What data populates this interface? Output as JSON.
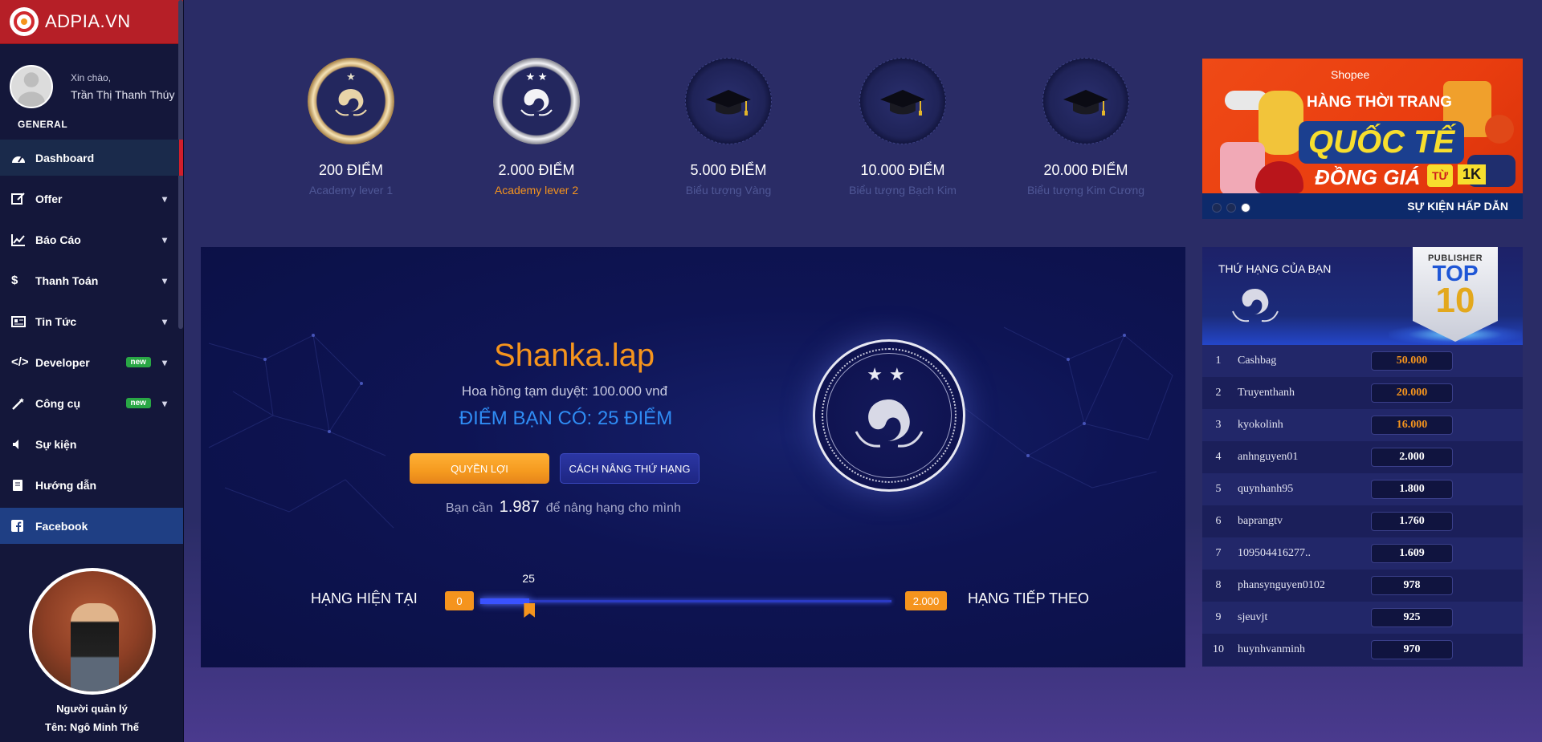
{
  "sidebar": {
    "brand": "ADPIA.VN",
    "greeting": "Xin chào,",
    "user_name": "Trần Thị Thanh Thúy",
    "section": "GENERAL",
    "items": [
      {
        "label": "Dashboard",
        "icon": "dashboard-icon"
      },
      {
        "label": "Offer",
        "icon": "edit-icon"
      },
      {
        "label": "Báo Cáo",
        "icon": "chart-icon"
      },
      {
        "label": "Thanh Toán",
        "icon": "dollar-icon"
      },
      {
        "label": "Tin Tức",
        "icon": "newspaper-icon"
      },
      {
        "label": "Developer",
        "icon": "code-icon",
        "badge": "new"
      },
      {
        "label": "Công cụ",
        "icon": "magic-wand-icon",
        "badge": "new"
      },
      {
        "label": "Sự kiện",
        "icon": "volume-icon"
      },
      {
        "label": "Hướng dẫn",
        "icon": "book-icon"
      },
      {
        "label": "Facebook",
        "icon": "facebook-icon"
      }
    ],
    "manager_role": "Người quản lý",
    "manager_name": "Tên: Ngô Minh Thế"
  },
  "levels": [
    {
      "points": "200 ĐIỂM",
      "name": "Academy lever 1",
      "medal": "gold"
    },
    {
      "points": "2.000 ĐIỂM",
      "name": "Academy lever 2",
      "medal": "silver",
      "current": true
    },
    {
      "points": "5.000 ĐIỂM",
      "name": "Biểu tượng Vàng",
      "medal": "locked"
    },
    {
      "points": "10.000 ĐIỂM",
      "name": "Biểu tượng Bạch Kim",
      "medal": "locked"
    },
    {
      "points": "20.000 ĐIỂM",
      "name": "Biểu tượng Kim Cương",
      "medal": "locked"
    }
  ],
  "banner": {
    "brand": "Shopee",
    "line1": "HÀNG THỜI TRANG",
    "line2": "QUỐC TẾ",
    "line3": "ĐỒNG GIÁ",
    "tu": "TỪ",
    "k": "1K",
    "event": "SỰ KIỆN HẤP DẪN",
    "slides": 3,
    "active_slide": 3
  },
  "main": {
    "shop_name": "Shanka.lap",
    "commission": "Hoa hồng tạm duyệt: 100.000 vnđ",
    "points_have": "ĐIỂM BẠN CÓ: 25 ĐIỂM",
    "btn_benefit": "QUYỀN LỢI",
    "btn_rank": "CÁCH NÂNG THỨ HẠNG",
    "need_prefix": "Bạn cần",
    "need_value": "1.987",
    "need_suffix": "để nâng hạng cho mình",
    "current_label": "HẠNG HIỆN TẠI",
    "next_label": "HẠNG TIẾP THEO",
    "range_start": "0",
    "range_end": "2.000",
    "progress_value": "25",
    "progress_fraction": 0.0125
  },
  "board": {
    "title": "THỨ HẠNG CỦA BẠN",
    "badge_pub": "PUBLISHER",
    "badge_top": "TOP",
    "badge_ten": "10",
    "rows": [
      {
        "rank": "1",
        "name": "Cashbag",
        "score": "50.000"
      },
      {
        "rank": "2",
        "name": "Truyenthanh",
        "score": "20.000"
      },
      {
        "rank": "3",
        "name": "kyokolinh",
        "score": "16.000"
      },
      {
        "rank": "4",
        "name": "anhnguyen01",
        "score": "2.000"
      },
      {
        "rank": "5",
        "name": "quynhanh95",
        "score": "1.800"
      },
      {
        "rank": "6",
        "name": "baprangtv",
        "score": "1.760"
      },
      {
        "rank": "7",
        "name": "109504416277..",
        "score": "1.609"
      },
      {
        "rank": "8",
        "name": "phansynguyen0102",
        "score": "978"
      },
      {
        "rank": "9",
        "name": "sjeuvjt",
        "score": "925"
      },
      {
        "rank": "10",
        "name": "huynhvanminh",
        "score": "970"
      }
    ]
  },
  "colors": {
    "brand_red": "#b61f27",
    "accent_orange": "#f5941d",
    "accent_blue": "#2f8cf4",
    "sidebar_bg": "#14173a",
    "page_bg": "#2a2c66"
  }
}
